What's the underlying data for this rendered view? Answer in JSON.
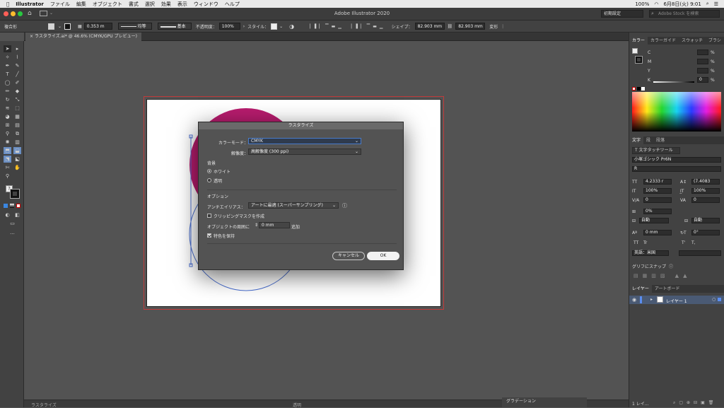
{
  "menubar": {
    "app": "Illustrator",
    "items": [
      "ファイル",
      "編集",
      "オブジェクト",
      "書式",
      "選択",
      "効果",
      "表示",
      "ウィンドウ",
      "ヘルプ"
    ],
    "clock": "6月8日(火) 9:01",
    "percent": "100%"
  },
  "appbar": {
    "title": "Adobe Illustrator 2020",
    "workspace": "初期設定",
    "search_placeholder": "Adobe Stock を検索"
  },
  "control_bar": {
    "selection_label": "複合形",
    "stroke_weight": "0.353 m",
    "stroke_profile": "均等",
    "brush": "基本",
    "opacity_label": "不透明度：",
    "opacity": "100%",
    "style_label": "スタイル：",
    "shape_label": "シェイプ：",
    "width": "82.903 mm",
    "height": "82.903 mm",
    "transform_label": "変形"
  },
  "document": {
    "tab_title": "ラスタライズ.ai* @ 46.6% (CMYK/GPU プレビュー)"
  },
  "dialog": {
    "title": "ラスタライズ",
    "color_mode_label": "カラーモード：",
    "color_mode": "CMYK",
    "resolution_label": "解像度：",
    "resolution": "高解像度 (300 ppi)",
    "background_label": "背景",
    "bg_white": "ホワイト",
    "bg_transparent": "透明",
    "options_label": "オプション",
    "antialias_label": "アンチエイリアス：",
    "antialias": "アートに最適 (スーパーサンプリング)",
    "clipping_mask": "クリッピングマスクを作成",
    "add_around_label": "オブジェクトの周囲に",
    "add_around_value": "0 mm",
    "add_around_suffix": "追加",
    "preserve_spot": "特色を保持",
    "cancel": "キャンセル",
    "ok": "OK"
  },
  "color_panel": {
    "tabs": [
      "カラー",
      "カラーガイド",
      "スウォッチ",
      "ブラシ"
    ],
    "channels": [
      {
        "name": "C",
        "value": "",
        "unit": "%"
      },
      {
        "name": "M",
        "value": "",
        "unit": "%"
      },
      {
        "name": "Y",
        "value": "",
        "unit": "%"
      },
      {
        "name": "K",
        "value": "0",
        "unit": "%"
      }
    ]
  },
  "character_panel": {
    "tabs": [
      "文字",
      "段",
      "段落"
    ],
    "touch_tool": "文字タッチツール",
    "font": "小塚ゴシック Pr6N",
    "style": "R",
    "size": "4.2333 r",
    "leading": "(7.4083",
    "vscale": "100%",
    "hscale": "100%",
    "kerning": "0",
    "tracking": "0",
    "tsume": "0%",
    "aki_before": "自動",
    "aki_after": "自動",
    "baseline": "0 mm",
    "rotation": "0°",
    "tt1": "TT",
    "tt2": "Tr",
    "tt3": "T'",
    "tt4": "T,",
    "language": "英語：米国"
  },
  "glyph_panel": {
    "title": "グリフにスナップ"
  },
  "layers_panel": {
    "tabs": [
      "レイヤー",
      "アートボード"
    ],
    "layer_name": "レイヤー 1",
    "footer": "1 レイ..."
  },
  "bottom": {
    "gradient_tab": "グラデーション",
    "zoom_tab1": "ラスタライズ",
    "tab2": "透明"
  },
  "colors": {
    "accent_blue": "#4a7cc9",
    "magenta": "#b81c6e",
    "artboard_bleed": "#c23b3b"
  }
}
